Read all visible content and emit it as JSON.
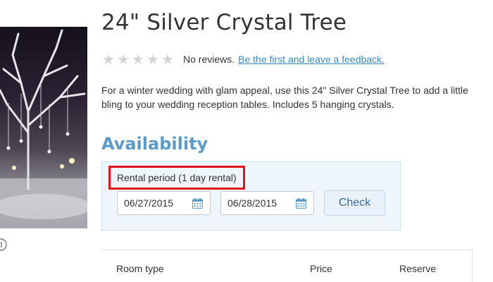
{
  "product": {
    "title": "24\" Silver Crystal Tree",
    "description": "For a winter wedding with glam appeal, use this 24\" Silver Crystal Tree to add a little bling to your wedding reception tables. Includes 5 hanging crystals."
  },
  "reviews": {
    "star_count": 5,
    "rating": 0,
    "no_reviews_text": "No reviews.",
    "first_review_link": "Be the first and leave a feedback."
  },
  "availability": {
    "heading": "Availability",
    "rental_period_label": "Rental period (1 day rental)",
    "start_date": "06/27/2015",
    "end_date": "06/28/2015",
    "check_label": "Check"
  },
  "rooms_table": {
    "columns": [
      "Room type",
      "Price",
      "Reserve"
    ]
  },
  "icons": {
    "calendar": "calendar-icon",
    "star": "star-icon",
    "slideshow_control": "circle-control-icon"
  },
  "colors": {
    "accent": "#5b9bc8",
    "link": "#3b8ac0",
    "highlight_border": "#e0141a",
    "panel_bg": "#eef5fb"
  }
}
